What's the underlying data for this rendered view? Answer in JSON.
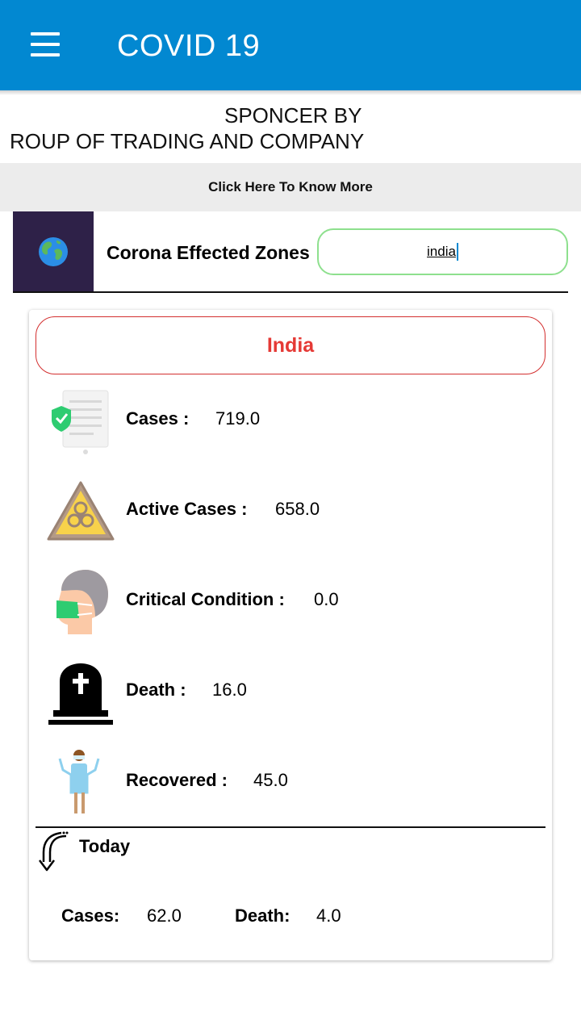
{
  "appbar": {
    "title": "COVID 19",
    "menu_icon": "hamburger-menu-icon",
    "color": "#0288d1"
  },
  "sponsor": {
    "line1": "SPONCER BY",
    "line2": "ROUP OF TRADING AND COMPANY"
  },
  "know_more": {
    "label": "Click Here To Know More"
  },
  "zones": {
    "label": "Corona Effected Zones",
    "search_value": "india",
    "icon": "globe-icon"
  },
  "country": {
    "name": "India",
    "accent": "#e53935"
  },
  "stats": [
    {
      "label": "Cases :",
      "value": "719.0",
      "icon": "shield-document-icon"
    },
    {
      "label": "Active Cases :",
      "value": "658.0",
      "icon": "biohazard-icon"
    },
    {
      "label": "Critical Condition :",
      "value": "0.0",
      "icon": "masked-face-icon"
    },
    {
      "label": "Death :",
      "value": "16.0",
      "icon": "tombstone-icon"
    },
    {
      "label": "Recovered :",
      "value": "45.0",
      "icon": "recovered-person-icon"
    }
  ],
  "today": {
    "label": "Today",
    "icon": "down-arrow-icon",
    "cases_label": "Cases:",
    "cases_value": "62.0",
    "death_label": "Death:",
    "death_value": "4.0"
  }
}
